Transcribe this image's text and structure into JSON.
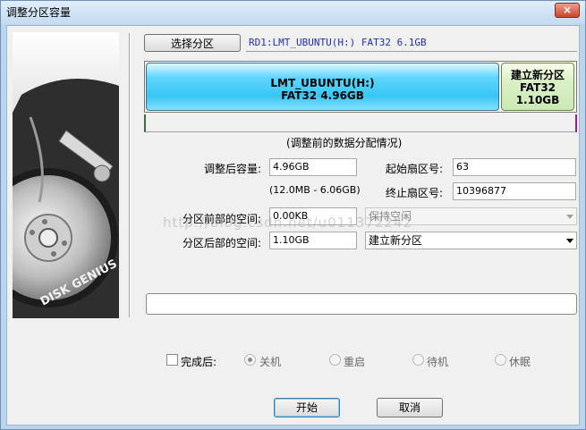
{
  "window": {
    "title": "调整分区容量",
    "close_glyph": "×"
  },
  "brand": {
    "logo_text": "DISK GENIUS"
  },
  "partition_select": {
    "button_label": "选择分区",
    "info": "RD1:LMT_UBUNTU(H:) FAT32 6.1GB"
  },
  "disk_map": {
    "segments": [
      {
        "line1": "LMT_UBUNTU(H:)",
        "line2": "FAT32 4.96GB"
      },
      {
        "line1": "建立新分区",
        "line2": "FAT32",
        "line3": "1.10GB"
      }
    ],
    "caption": "(调整前的数据分配情况)"
  },
  "form": {
    "new_size_label": "调整后容量:",
    "new_size_value": "4.96GB",
    "size_range": "(12.0MB - 6.06GB)",
    "start_sector_label": "起始扇区号:",
    "start_sector_value": "63",
    "end_sector_label": "终止扇区号:",
    "end_sector_value": "10396877",
    "space_before_label": "分区前部的空间:",
    "space_before_value": "0.00KB",
    "space_before_action": "保持空闲",
    "space_after_label": "分区后部的空间:",
    "space_after_value": "1.10GB",
    "space_after_action": "建立新分区"
  },
  "after_complete": {
    "label": "完成后:",
    "options": [
      "关机",
      "重启",
      "待机",
      "休眠"
    ]
  },
  "buttons": {
    "start": "开始",
    "cancel": "取消"
  },
  "watermark": "http://blog.csdn.net/u011372242",
  "colors": {
    "partition1": "#39c6f4",
    "partition2": "#cbe9b4",
    "info_text": "#2030b0"
  }
}
